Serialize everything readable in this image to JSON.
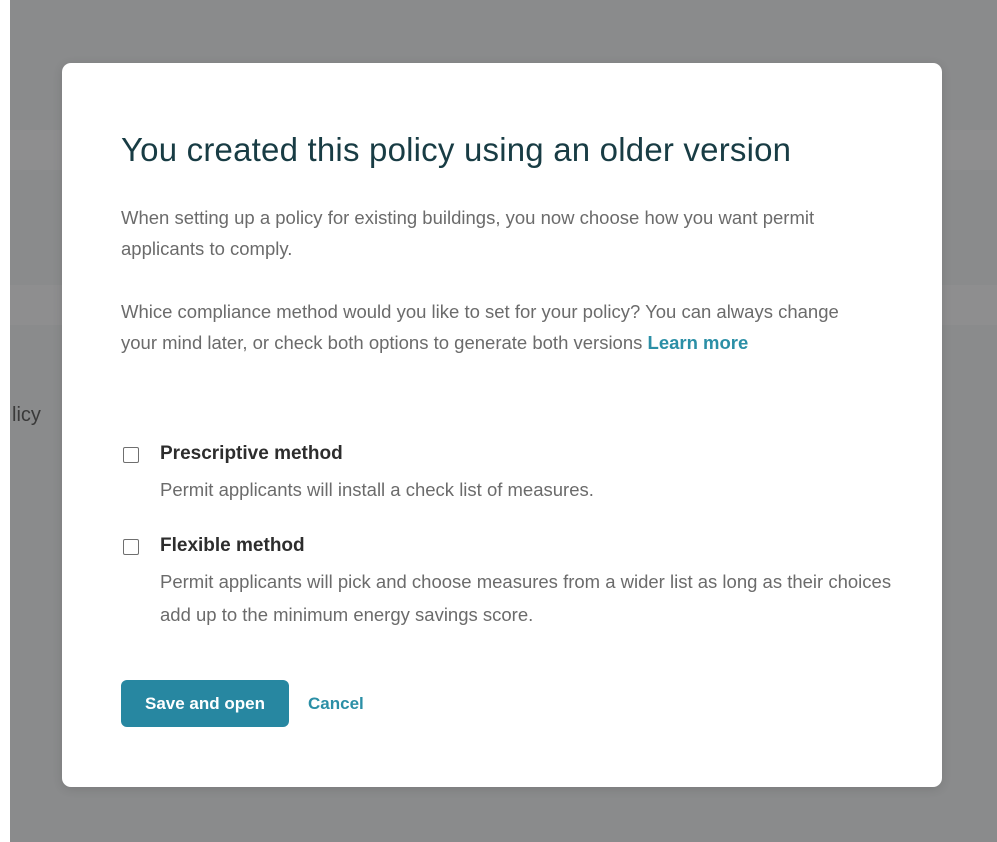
{
  "background": {
    "page_label_fragment": "licy"
  },
  "modal": {
    "title": "You created this policy using an older version",
    "paragraph_1": "When setting up a policy for existing buildings, you now choose how you want permit applicants to comply.",
    "paragraph_2": "Whice compliance method would you like to set for your policy? You can always change your mind later, or check both options to generate both versions",
    "learn_more": "Learn more",
    "options": [
      {
        "label": "Prescriptive method",
        "description": "Permit applicants will install a check list of measures.",
        "checked": false
      },
      {
        "label": "Flexible method",
        "description": "Permit applicants will pick and choose measures from a wider list as long as their choices add up to the minimum energy savings score.",
        "checked": false
      }
    ],
    "primary_button": "Save and open",
    "cancel_button": "Cancel"
  },
  "colors": {
    "accent": "#2787a1",
    "title": "#183c44",
    "overlay": "#8a8b8c"
  }
}
